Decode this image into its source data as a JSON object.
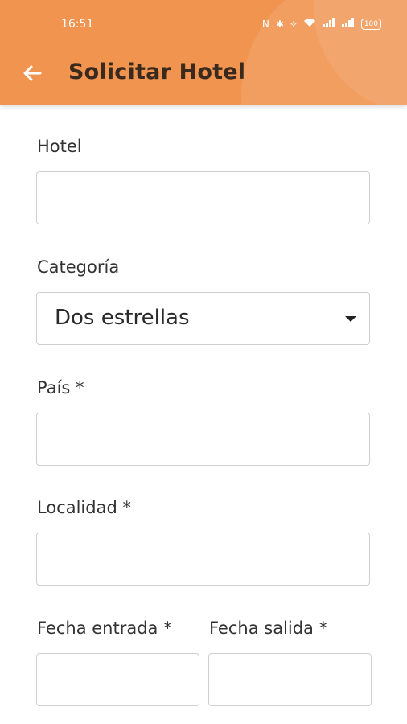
{
  "status_bar": {
    "time": "16:51",
    "icons": [
      "nfc-icon",
      "bluetooth-icon",
      "vibrate-icon",
      "wifi-icon",
      "signal-icon",
      "signal-icon-2"
    ],
    "battery": "100"
  },
  "app_bar": {
    "title": "Solicitar Hotel",
    "back_icon": "arrow-left-icon",
    "color": "#f0944f"
  },
  "form": {
    "hotel": {
      "label": "Hotel",
      "value": ""
    },
    "categoria": {
      "label": "Categoría",
      "value": "Dos estrellas"
    },
    "pais": {
      "label": "País *",
      "value": ""
    },
    "localidad": {
      "label": "Localidad *",
      "value": ""
    },
    "fecha_entrada": {
      "label": "Fecha entrada *",
      "value": ""
    },
    "fecha_salida": {
      "label": "Fecha salida *",
      "value": ""
    }
  }
}
